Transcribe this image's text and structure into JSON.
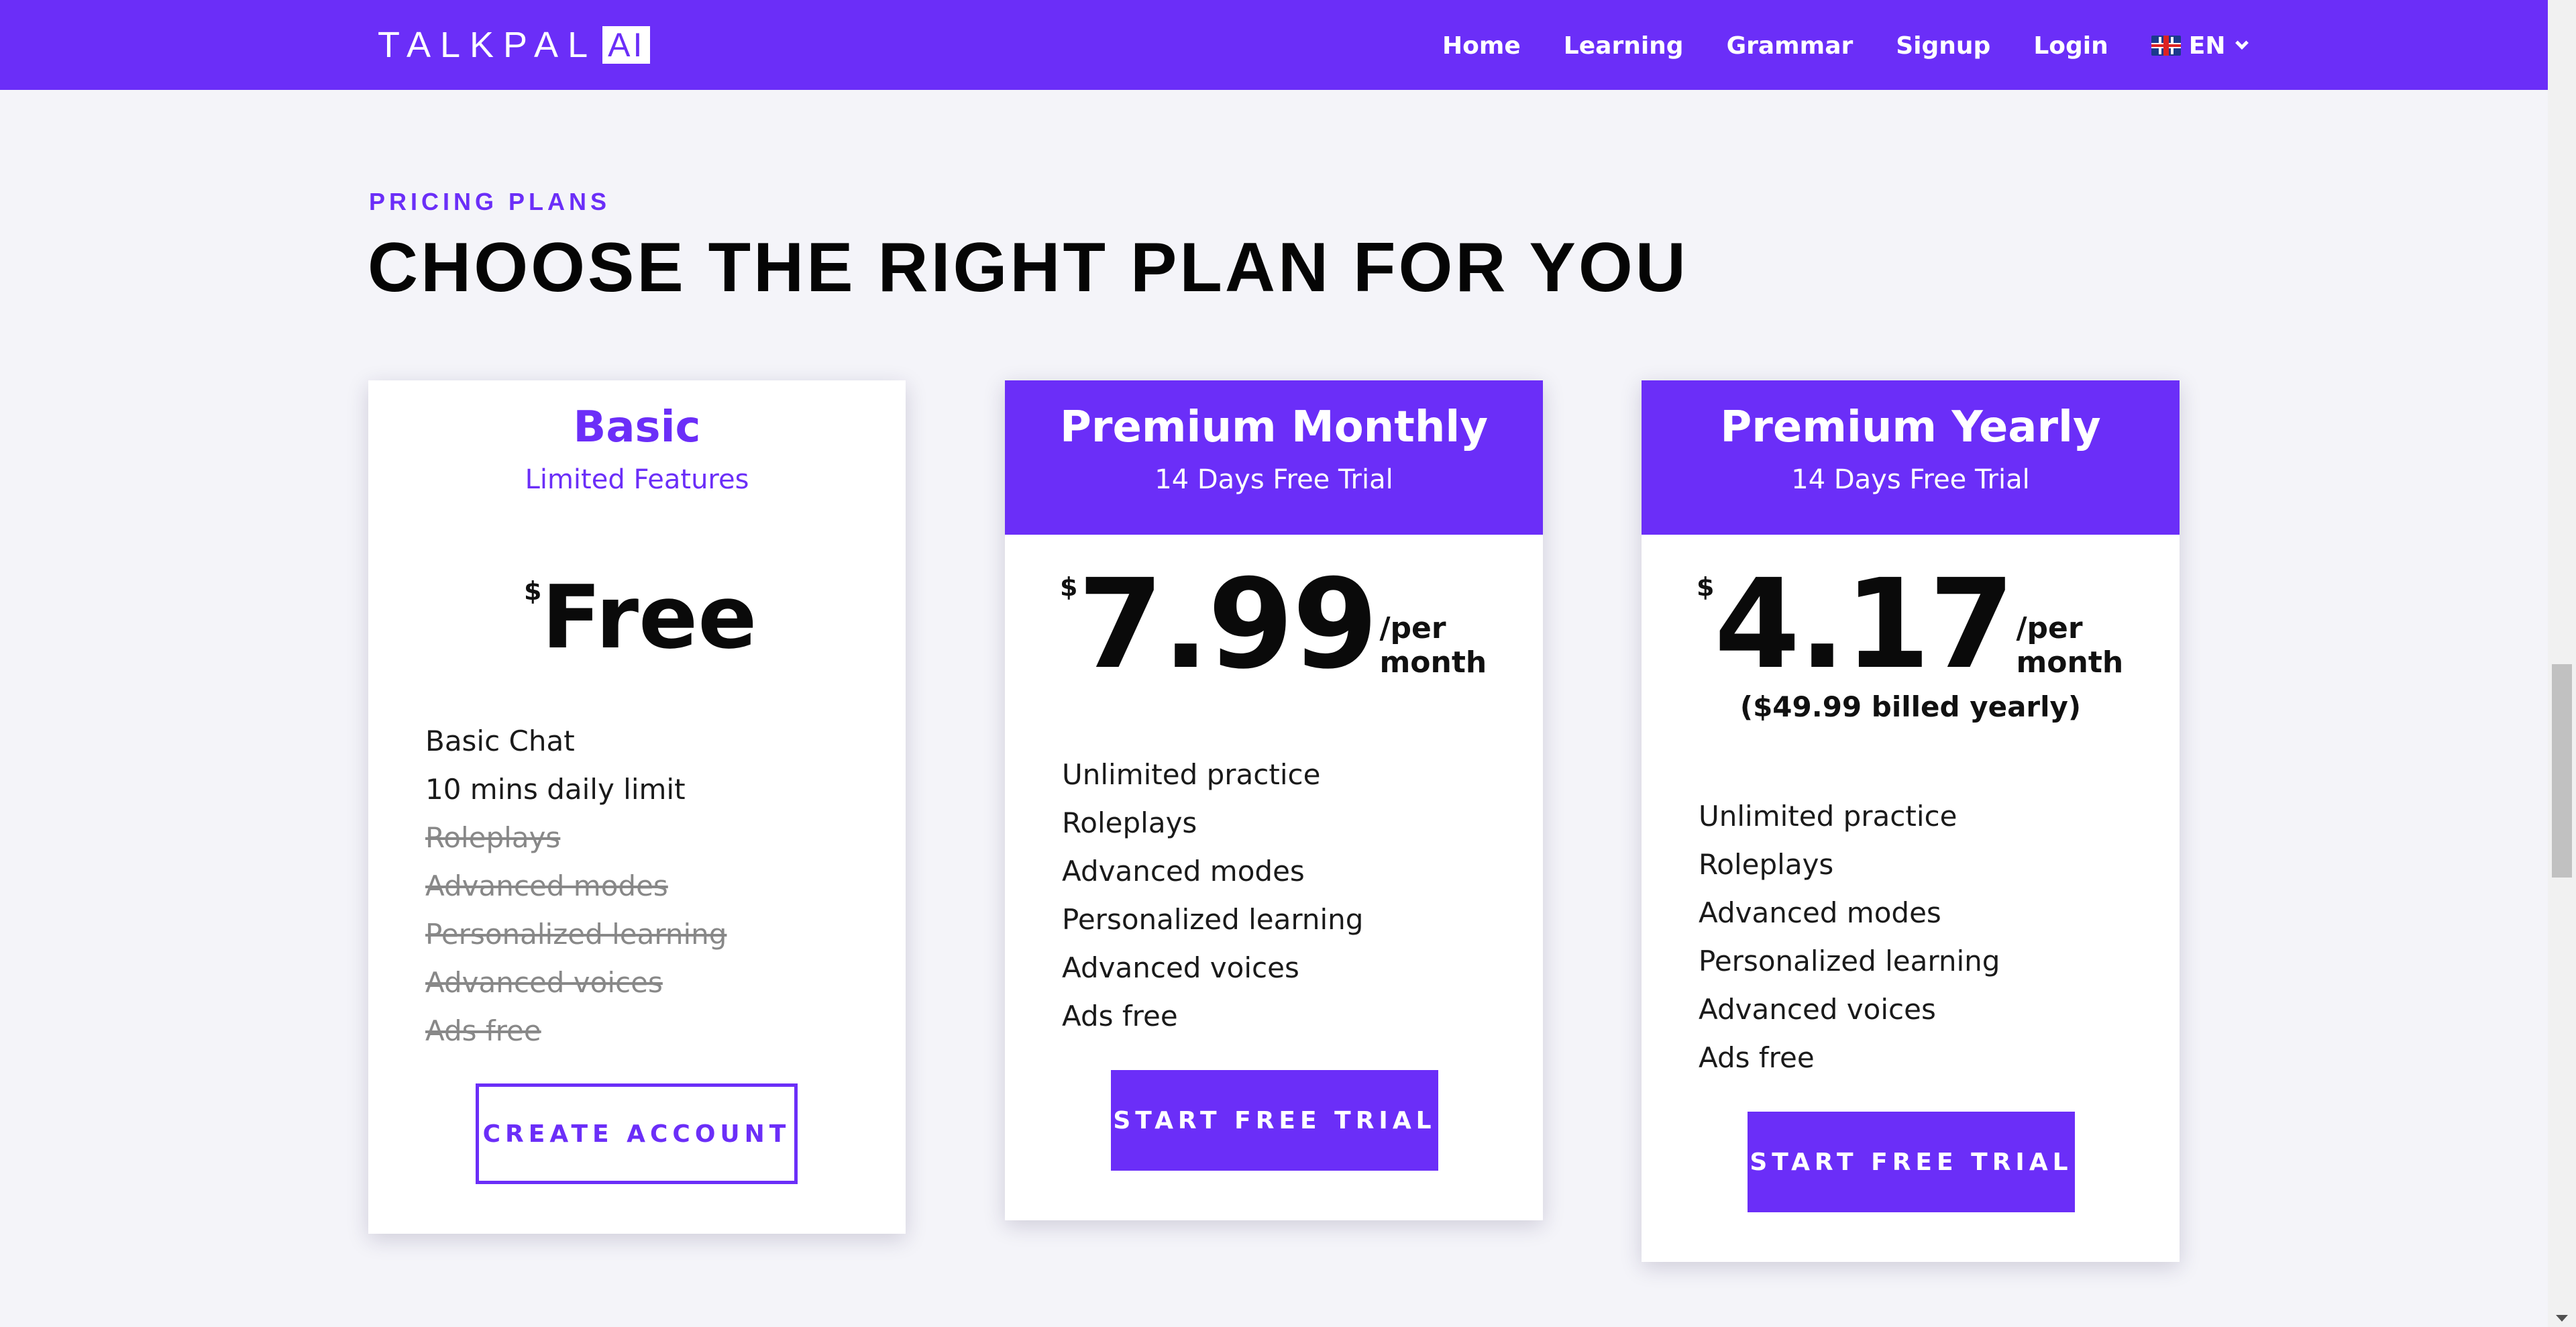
{
  "header": {
    "logo_text": "TALKPAL",
    "logo_badge": "AI",
    "nav": [
      "Home",
      "Learning",
      "Grammar",
      "Signup",
      "Login"
    ],
    "language": "EN"
  },
  "section": {
    "eyebrow": "PRICING PLANS",
    "title": "CHOOSE THE RIGHT PLAN FOR YOU"
  },
  "plans": [
    {
      "name": "Basic",
      "subtitle": "Limited Features",
      "currency": "$",
      "price": "Free",
      "period": "",
      "billed": "",
      "features": [
        {
          "label": "Basic Chat",
          "included": true
        },
        {
          "label": "10 mins daily limit",
          "included": true
        },
        {
          "label": "Roleplays",
          "included": false
        },
        {
          "label": "Advanced modes",
          "included": false
        },
        {
          "label": "Personalized learning",
          "included": false
        },
        {
          "label": "Advanced voices",
          "included": false
        },
        {
          "label": "Ads free",
          "included": false
        }
      ],
      "cta": "CREATE ACCOUNT"
    },
    {
      "name": "Premium Monthly",
      "subtitle": "14 Days Free Trial",
      "currency": "$",
      "price": "7.99",
      "period": "/per month",
      "billed": "",
      "features": [
        {
          "label": "Unlimited practice",
          "included": true
        },
        {
          "label": "Roleplays",
          "included": true
        },
        {
          "label": "Advanced modes",
          "included": true
        },
        {
          "label": "Personalized learning",
          "included": true
        },
        {
          "label": "Advanced voices",
          "included": true
        },
        {
          "label": "Ads free",
          "included": true
        }
      ],
      "cta": "START FREE TRIAL"
    },
    {
      "name": "Premium Yearly",
      "subtitle": "14 Days Free Trial",
      "currency": "$",
      "price": "4.17",
      "period": "/per month",
      "billed": "($49.99 billed yearly)",
      "features": [
        {
          "label": "Unlimited practice",
          "included": true
        },
        {
          "label": "Roleplays",
          "included": true
        },
        {
          "label": "Advanced modes",
          "included": true
        },
        {
          "label": "Personalized learning",
          "included": true
        },
        {
          "label": "Advanced voices",
          "included": true
        },
        {
          "label": "Ads free",
          "included": true
        }
      ],
      "cta": "START FREE TRIAL"
    }
  ],
  "colors": {
    "brand": "#6b2ef8",
    "background": "#f4f4f9",
    "muted_feature": "#888888"
  },
  "icons": {
    "language_flag": "uk-flag-icon",
    "language_dropdown": "chevron-down-icon"
  }
}
